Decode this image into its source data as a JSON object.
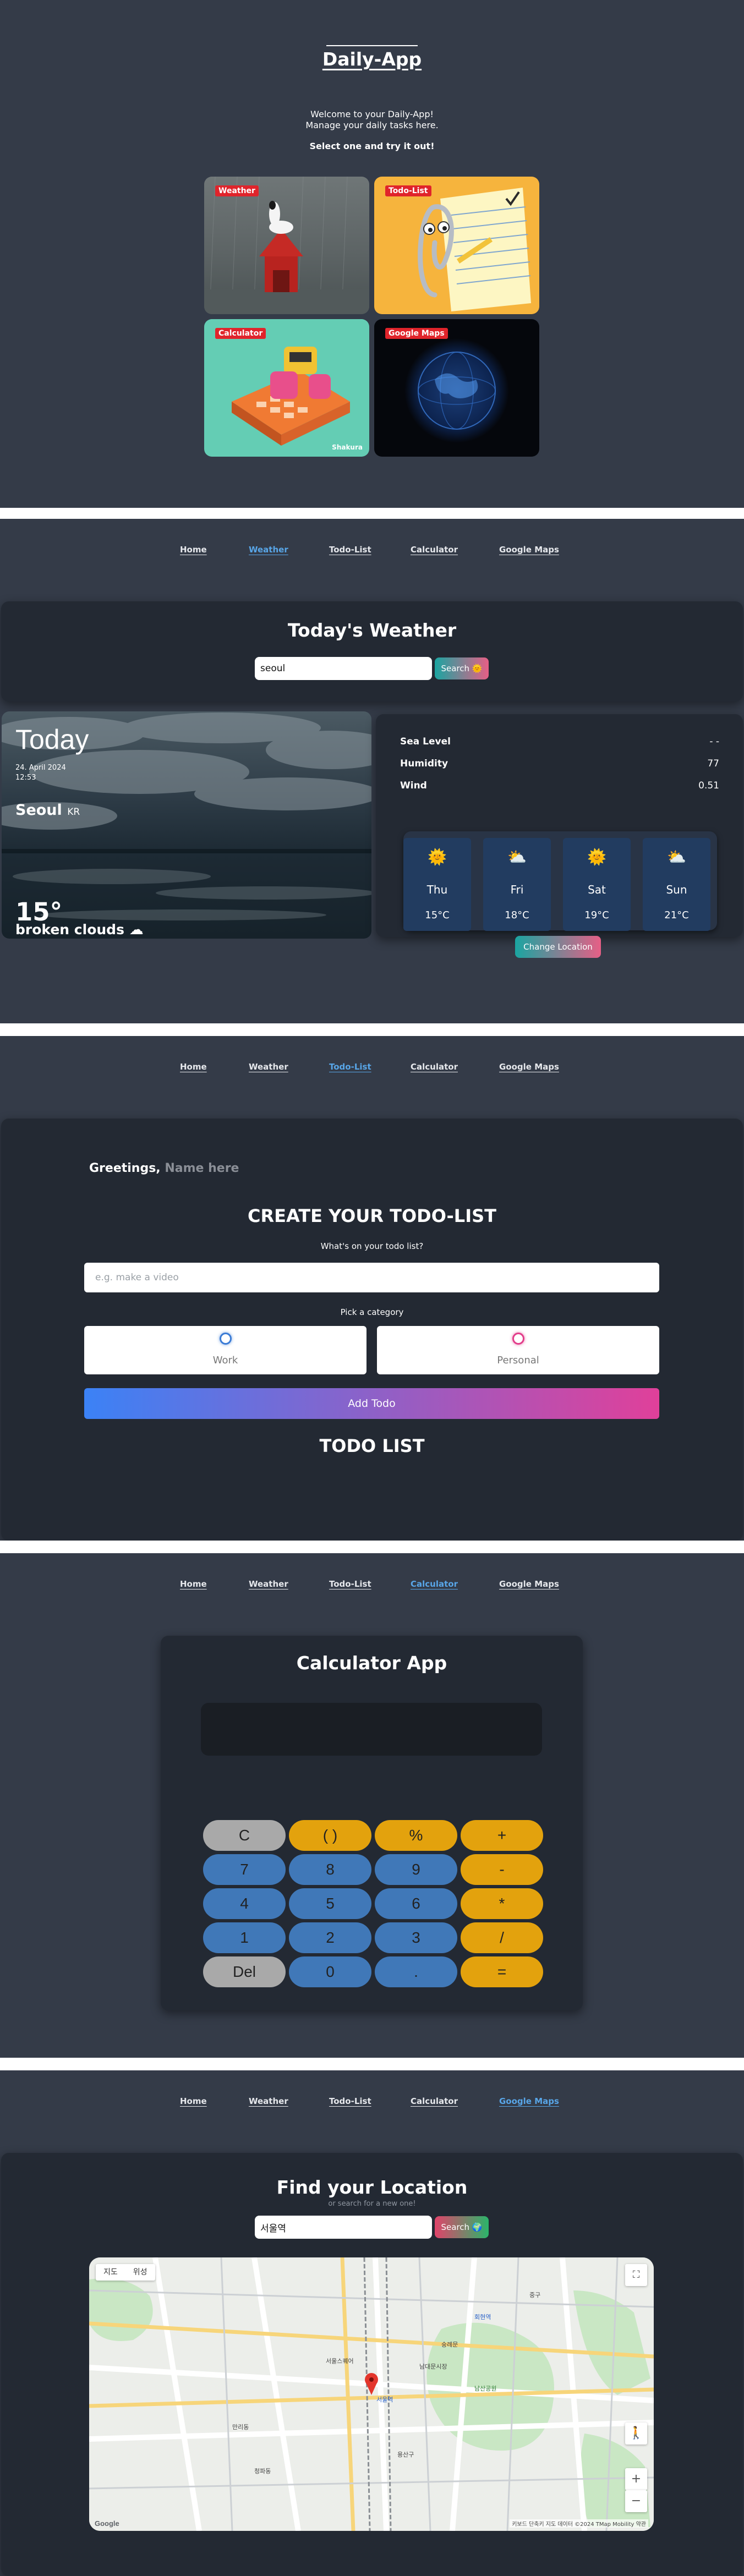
{
  "home": {
    "title": "Daily-App",
    "welcome": "Welcome to your Daily-App!",
    "manage": "Manage your daily tasks here.",
    "select": "Select one and try it out!",
    "cards": [
      "Weather",
      "Todo-List",
      "Calculator",
      "Google Maps"
    ],
    "watermark": "Shakura"
  },
  "nav": [
    "Home",
    "Weather",
    "Todo-List",
    "Calculator",
    "Google Maps"
  ],
  "weather": {
    "title": "Today's Weather",
    "input_value": "seoul",
    "search_label": "Search",
    "today": "Today",
    "date": "24. April 2024",
    "time": "12:53",
    "city": "Seoul",
    "country": "KR",
    "temp": "15°",
    "description": "broken clouds",
    "stats": [
      {
        "label": "Sea Level",
        "value": "- -"
      },
      {
        "label": "Humidity",
        "value": "77"
      },
      {
        "label": "Wind",
        "value": "0.51"
      }
    ],
    "forecast": [
      {
        "day": "Thu",
        "temp": "15°C",
        "icon": "sun-icon"
      },
      {
        "day": "Fri",
        "temp": "18°C",
        "icon": "cloud-icon"
      },
      {
        "day": "Sat",
        "temp": "19°C",
        "icon": "sun-icon"
      },
      {
        "day": "Sun",
        "temp": "21°C",
        "icon": "cloud-icon"
      }
    ],
    "change_label": "Change Location"
  },
  "todo": {
    "greeting": "Greetings,",
    "name_placeholder": "Name here",
    "title": "CREATE YOUR TODO-LIST",
    "question": "What's on your todo list?",
    "input_placeholder": "e.g. make a video",
    "pick": "Pick a category",
    "categories": [
      "Work",
      "Personal"
    ],
    "add_label": "Add Todo",
    "list_title": "TODO LIST"
  },
  "calculator": {
    "title": "Calculator App",
    "keys": [
      "C",
      "( )",
      "%",
      "+",
      "7",
      "8",
      "9",
      "-",
      "4",
      "5",
      "6",
      "*",
      "1",
      "2",
      "3",
      "/",
      "Del",
      "0",
      ".",
      "="
    ]
  },
  "maps": {
    "title": "Find your Location",
    "subtitle": "or search for a new one!",
    "input_value": "서울역",
    "search_label": "Search",
    "map_tabs": [
      "지도",
      "위성"
    ],
    "map_labels": [
      "서울역",
      "남대문시장",
      "숭례문",
      "서울스퀘어",
      "회현역",
      "용산구",
      "중구",
      "남산공원",
      "만리동",
      "청파동"
    ],
    "google": "Google",
    "attribution": "키보드 단축키  지도 데이터 ©2024 TMap Mobility  약관"
  },
  "colors": {
    "background": "#343b48",
    "panel": "#232933",
    "nav_active": "#58a6e8",
    "card_label": "#e0242b"
  }
}
